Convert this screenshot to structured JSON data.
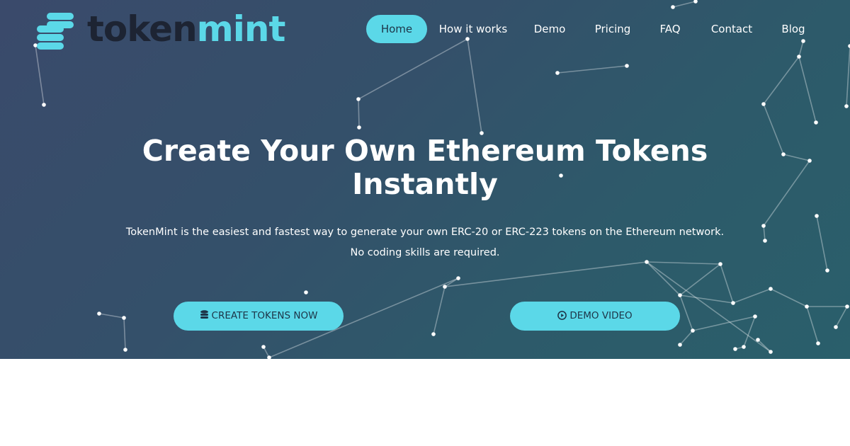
{
  "brand": {
    "part1": "token",
    "part2": "mint",
    "accent_color": "#5bd8e8",
    "dark_color": "#1d2433",
    "icon": "coin-stack-icon"
  },
  "nav": {
    "items": [
      {
        "label": "Home",
        "active": true
      },
      {
        "label": "How it works",
        "active": false
      },
      {
        "label": "Demo",
        "active": false
      },
      {
        "label": "Pricing",
        "active": false
      },
      {
        "label": "FAQ",
        "active": false
      },
      {
        "label": "Contact",
        "active": false
      },
      {
        "label": "Blog",
        "active": false
      }
    ]
  },
  "hero": {
    "title_line1": "Create Your Own Ethereum Tokens",
    "title_line2": "Instantly",
    "subtitle_line1": "TokenMint is the easiest and fastest way to generate your own ERC-20 or ERC-223 tokens on the Ethereum network.",
    "subtitle_line2": "No coding skills are required.",
    "background_colors": [
      "#3a4a6b",
      "#2a5f6b"
    ]
  },
  "cta": {
    "primary": {
      "label": "CREATE TOKENS NOW",
      "icon": "database-icon"
    },
    "secondary": {
      "label": "DEMO VIDEO",
      "icon": "play-circle-icon"
    }
  }
}
